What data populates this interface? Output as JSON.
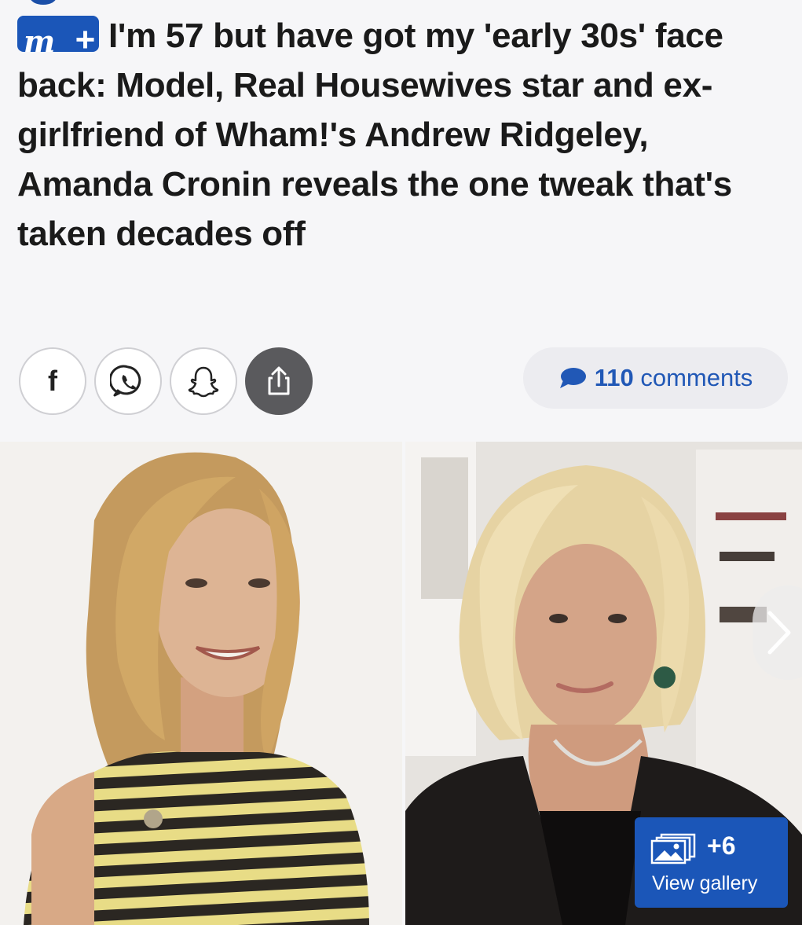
{
  "article": {
    "badge": {
      "label": "m+"
    },
    "headline": "I'm 57 but have got my 'early 30s' face back: Model, Real Housewives star and ex-girlfriend of Wham!'s Andrew Ridgeley, Amanda Cronin reveals the one tweak that's taken decades off"
  },
  "share": {
    "buttons": [
      {
        "name": "facebook",
        "icon": "facebook-icon",
        "glyph": "f"
      },
      {
        "name": "whatsapp",
        "icon": "whatsapp-icon"
      },
      {
        "name": "snapchat",
        "icon": "snapchat-icon"
      },
      {
        "name": "share",
        "icon": "share-icon"
      }
    ]
  },
  "comments": {
    "count": "110",
    "word": "comments",
    "icon": "speech-bubble-icon"
  },
  "gallery": {
    "count": "+6",
    "label": "View gallery",
    "icon": "gallery-icon"
  },
  "carousel": {
    "next_icon": "chevron-right-icon"
  },
  "colors": {
    "brand_blue": "#1b56b8",
    "background": "#f6f6f8",
    "comments_pill": "#ececf0",
    "share_dark": "#5a5a5d"
  }
}
